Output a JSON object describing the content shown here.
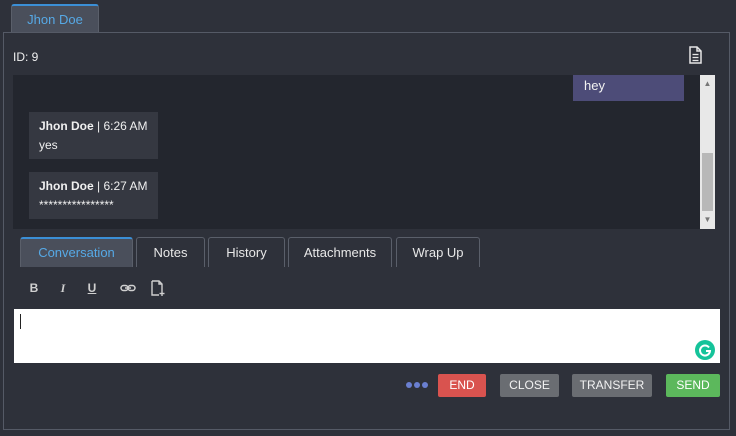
{
  "contact_tab": {
    "label": "Jhon Doe"
  },
  "header": {
    "id_label": "ID: 9",
    "transcript_icon": "document-icon"
  },
  "chat": {
    "outgoing": [
      {
        "text": "hey"
      }
    ],
    "incoming": [
      {
        "sender": "Jhon Doe",
        "separator": "|",
        "time": "6:26 AM",
        "text": "yes"
      },
      {
        "sender": "Jhon Doe",
        "separator": "|",
        "time": "6:27 AM",
        "text": "****************"
      }
    ]
  },
  "tabs": [
    {
      "label": "Conversation",
      "active": true
    },
    {
      "label": "Notes"
    },
    {
      "label": "History"
    },
    {
      "label": "Attachments"
    },
    {
      "label": "Wrap Up"
    }
  ],
  "toolbar": {
    "bold": "B",
    "italic": "I",
    "underline": "U"
  },
  "editor": {
    "value": ""
  },
  "actions": {
    "end": "END",
    "close": "CLOSE",
    "transfer": "TRANSFER",
    "send": "SEND"
  },
  "colors": {
    "accent": "#3b8fd6",
    "end": "#d9534f",
    "send": "#5cb85c",
    "neutral_button": "#6a6d72",
    "outgoing_bubble": "#4d4c78",
    "incoming_bubble": "#353841"
  }
}
